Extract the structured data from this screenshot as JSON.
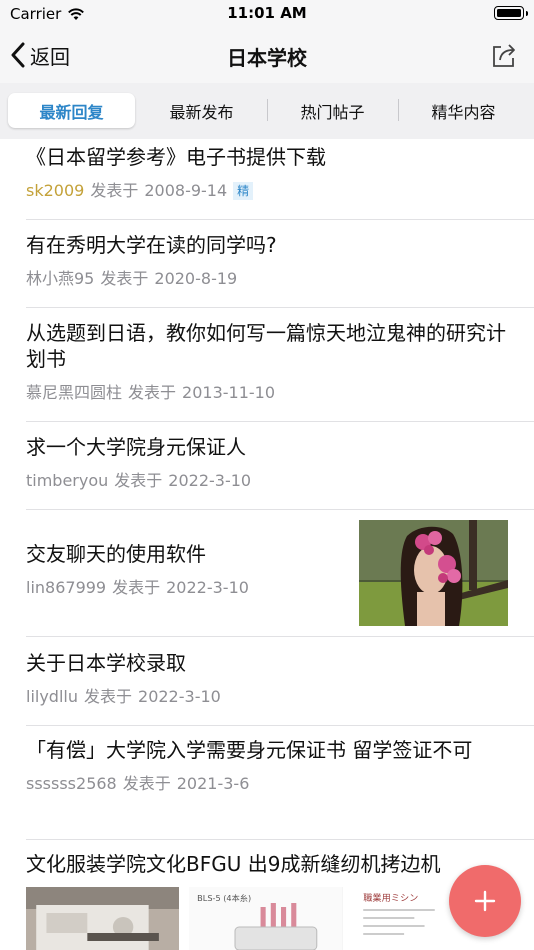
{
  "status_bar": {
    "carrier": "Carrier",
    "time": "11:01 AM"
  },
  "nav": {
    "back_label": "返回",
    "title": "日本学校"
  },
  "tabs": [
    {
      "label": "最新回复",
      "active": true
    },
    {
      "label": "最新发布",
      "active": false
    },
    {
      "label": "热门帖子",
      "active": false
    },
    {
      "label": "精华内容",
      "active": false
    }
  ],
  "posts": [
    {
      "title": "《日本留学参考》电子书提供下载",
      "author": "sk2009",
      "posted": "发表于",
      "date": "2008-9-14",
      "badge": "精"
    },
    {
      "title": "有在秀明大学在读的同学吗?",
      "author": "林小燕95",
      "posted": "发表于",
      "date": "2020-8-19"
    },
    {
      "title": "从选题到日语，教你如何写一篇惊天地泣鬼神的研究计划书",
      "author": "慕尼黑四圆柱",
      "posted": "发表于",
      "date": "2013-11-10"
    },
    {
      "title": "求一个大学院身元保证人",
      "author": "timberyou",
      "posted": "发表于",
      "date": "2022-3-10"
    },
    {
      "title": "交友聊天的使用软件",
      "author": "lin867999",
      "posted": "发表于",
      "date": "2022-3-10"
    },
    {
      "title": "关于日本学校录取",
      "author": "lilydllu",
      "posted": "发表于",
      "date": "2022-3-10"
    },
    {
      "title": "「有偿」大学院入学需要身元保证书 留学签证不可",
      "author": "ssssss2568",
      "posted": "发表于",
      "date": "2021-3-6"
    },
    {
      "title": "文化服装学院文化BFGU 出9成新缝纫机拷边机"
    }
  ],
  "strip_texts": {
    "img2_label": "BLS-5 (4本糸)",
    "img3_label": "職業用ミシン"
  },
  "colors": {
    "accent": "#2d86c8",
    "fab": "#f06b6b",
    "author_highlight": "#c4a23a"
  },
  "icons": {
    "back": "chevron-left-icon",
    "share": "share-icon",
    "fab": "plus-icon",
    "wifi": "wifi-icon",
    "battery": "battery-icon"
  }
}
